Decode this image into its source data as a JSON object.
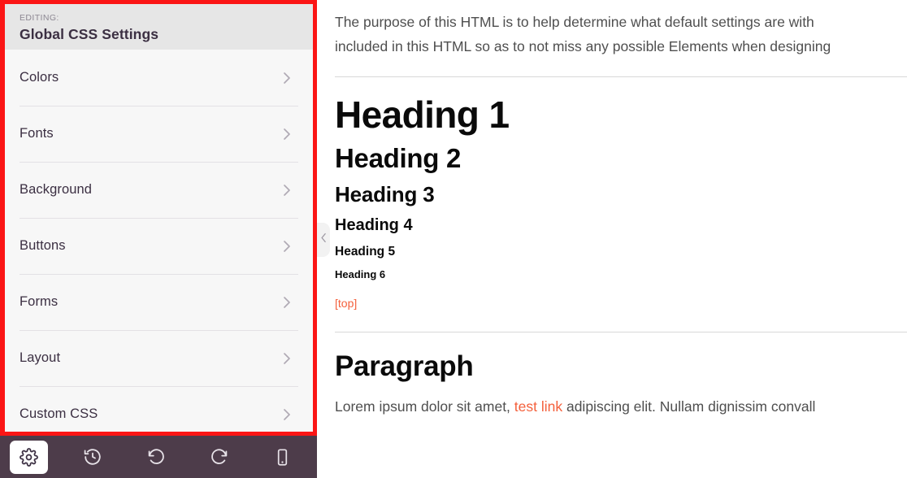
{
  "panel": {
    "editing_label": "EDITING:",
    "title": "Global CSS Settings",
    "highlight_color": "#fb1515",
    "header_bg": "#e6e6e6",
    "items": [
      {
        "label": "Colors",
        "icon": "chevron-right-icon"
      },
      {
        "label": "Fonts",
        "icon": "chevron-right-icon"
      },
      {
        "label": "Background",
        "icon": "chevron-right-icon"
      },
      {
        "label": "Buttons",
        "icon": "chevron-right-icon"
      },
      {
        "label": "Forms",
        "icon": "chevron-right-icon"
      },
      {
        "label": "Layout",
        "icon": "chevron-right-icon"
      },
      {
        "label": "Custom CSS",
        "icon": "chevron-right-icon"
      }
    ]
  },
  "toolbar": {
    "background": "#4d3c4a",
    "buttons": [
      {
        "name": "settings",
        "icon": "gear-icon",
        "active": true
      },
      {
        "name": "history",
        "icon": "history-clock-icon",
        "active": false
      },
      {
        "name": "undo",
        "icon": "undo-icon",
        "active": false
      },
      {
        "name": "redo",
        "icon": "redo-icon",
        "active": false
      },
      {
        "name": "responsive-preview",
        "icon": "mobile-device-icon",
        "active": false
      }
    ]
  },
  "collapse_handle": {
    "icon": "chevron-left-icon"
  },
  "content": {
    "intro_line_1": "The purpose of this HTML is to help determine what default settings are with",
    "intro_line_2": "included in this HTML so as to not miss any possible Elements when designing",
    "headings": {
      "h1": "Heading 1",
      "h2": "Heading 2",
      "h3": "Heading 3",
      "h4": "Heading 4",
      "h5": "Heading 5",
      "h6": "Heading 6"
    },
    "top_link": "[top]",
    "paragraph_title": "Paragraph",
    "paragraph_before_link": "Lorem ipsum dolor sit amet, ",
    "paragraph_link": "test link",
    "paragraph_after_link": " adipiscing elit. Nullam dignissim convall",
    "link_color": "#f4603c"
  }
}
